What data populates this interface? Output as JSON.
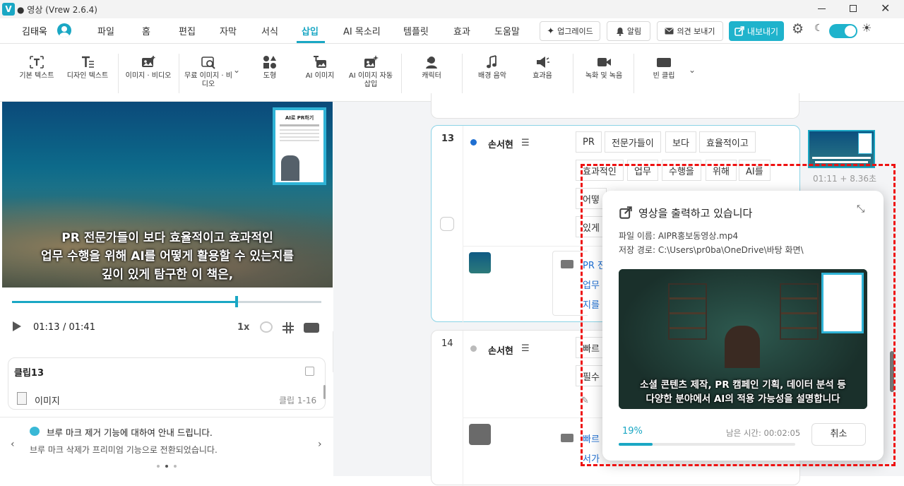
{
  "title_bar": {
    "app_title": "● 영상 (Vrew 2.6.4)"
  },
  "menu": {
    "user": "김태욱",
    "items": [
      "파일",
      "홈",
      "편집",
      "자막",
      "서식",
      "삽입",
      "AI 목소리",
      "템플릿",
      "효과",
      "도움말"
    ],
    "active": "삽입",
    "upgrade": "업그레이드",
    "notify": "알림",
    "feedback": "의견 보내기",
    "export": "내보내기"
  },
  "toolbar": {
    "tools": [
      "기본 텍스트",
      "디자인 텍스트",
      "이미지 · 비디오",
      "무료 이미지 · 비디오",
      "도형",
      "AI 이미지",
      "AI 이미지 자동 삽입",
      "캐릭터",
      "배경 음악",
      "효과음",
      "녹화 및 녹음",
      "빈 클립"
    ]
  },
  "video": {
    "subtitle_lines": [
      "PR 전문가들이 보다 효율적이고 효과적인",
      "업무 수행을 위해 AI를 어떻게 활용할 수 있는지를",
      "깊이 있게 탐구한 이 책은,"
    ],
    "book_title": "AI로 PR하기"
  },
  "player": {
    "current_time": "01:13",
    "total_time": "/ 01:41",
    "speed": "1x",
    "progress": 0.725
  },
  "clip_panel": {
    "title": "클립13",
    "item_label": "이미지",
    "item_range": "클립 1-16"
  },
  "notice": {
    "title": "브루 마크 제거 기능에 대하여 안내 드립니다.",
    "body": "브루 마크 삭제가 프리미엄 기능으로 전환되었습니다."
  },
  "clip13": {
    "number": "13",
    "speaker": "손서현",
    "words_row1": [
      "PR",
      "전문가들이",
      "보다",
      "효율적이고"
    ],
    "words_row2": [
      "효과적인",
      "업무",
      "수행을",
      "위해",
      "AI를"
    ],
    "partial_row3": "어떻",
    "partial_row4": "있게",
    "thumb_time": "01:11 + 8.36초",
    "text_lines": [
      "PR 전",
      "업무",
      "지를"
    ]
  },
  "clip14": {
    "number": "14",
    "speaker": "손서현",
    "partial_row1": "빠르",
    "partial_row2": "필수",
    "text_lines": [
      "빠르",
      "서가"
    ]
  },
  "export_dialog": {
    "title": "영상을 출력하고 있습니다",
    "file_name": "파일 이름: AIPR홍보동영상.mp4",
    "save_path": "저장 경로: C:\\Users\\pr0ba\\OneDrive\\바탕 화면\\",
    "preview_subtitle": [
      "소셜 콘텐츠 제작, PR 캠페인 기획, 데이터 분석 등",
      "다양한 분야에서 AI의 적용 가능성을 설명합니다"
    ],
    "progress_label": "19%",
    "progress": 0.19,
    "remaining": "남은 시간: 00:02:05",
    "cancel": "취소"
  },
  "colors": {
    "accent": "#1aa7c4",
    "highlight": "#e11111"
  }
}
